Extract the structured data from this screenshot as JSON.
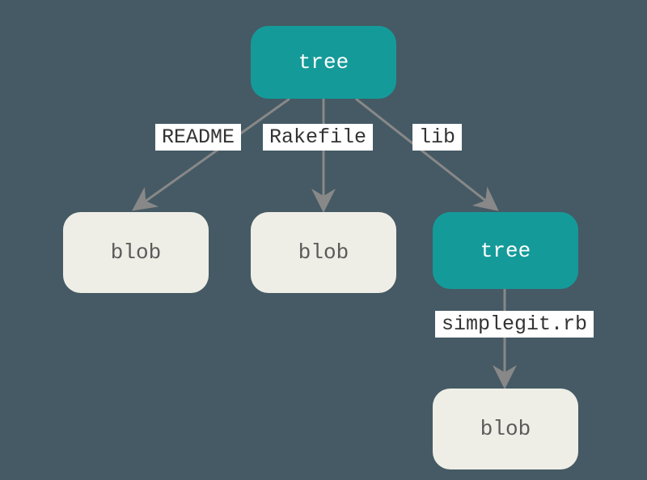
{
  "nodes": {
    "root": {
      "label": "tree"
    },
    "blob1": {
      "label": "blob"
    },
    "blob2": {
      "label": "blob"
    },
    "subtree": {
      "label": "tree"
    },
    "blob3": {
      "label": "blob"
    }
  },
  "edges": {
    "readme": {
      "label": "README"
    },
    "rakefile": {
      "label": "Rakefile"
    },
    "lib": {
      "label": "lib"
    },
    "simplegit": {
      "label": "simplegit.rb"
    }
  }
}
